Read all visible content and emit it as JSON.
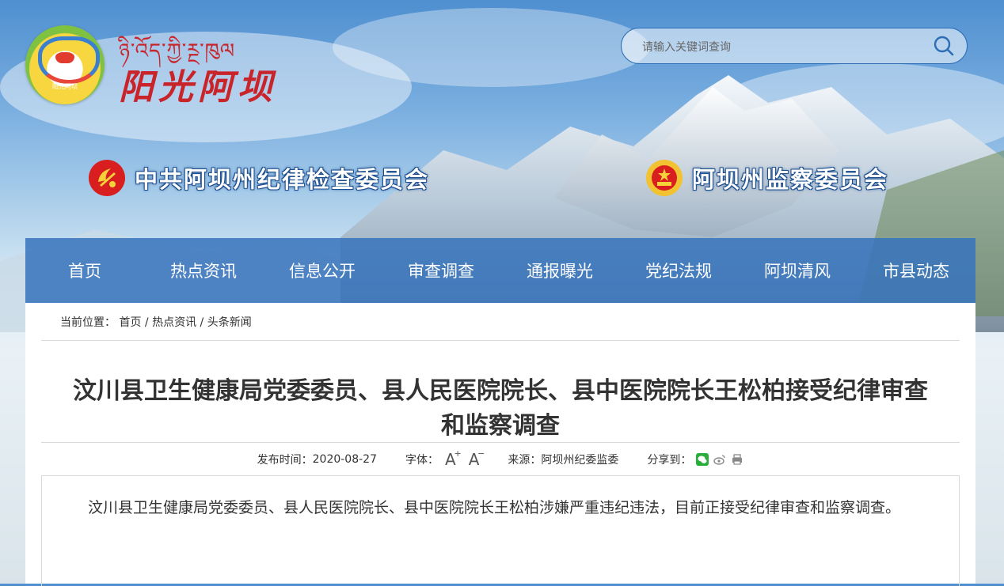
{
  "header": {
    "logo_caption": "阳光阿坝",
    "tibetan_title": "ཉི་འོད་ཀྱི་ཪྔ་ཁུལ",
    "brand_title": "阳光阿坝",
    "search": {
      "placeholder": "请输入关键词查询"
    },
    "orgs": [
      {
        "name": "中共阿坝州纪律检查委员会"
      },
      {
        "name": "阿坝州监察委员会"
      }
    ]
  },
  "nav": {
    "items": [
      "首页",
      "热点资讯",
      "信息公开",
      "审查调查",
      "通报曝光",
      "党纪法规",
      "阿坝清风",
      "市县动态"
    ]
  },
  "breadcrumb": {
    "prefix": "当前位置：",
    "items": [
      "首页",
      "热点资讯",
      "头条新闻"
    ],
    "separator": "/"
  },
  "article": {
    "title": "汶川县卫生健康局党委委员、县人民医院院长、县中医院院长王松柏接受纪律审查和监察调查",
    "published_label": "发布时间：",
    "published_date": "2020-08-27",
    "font_label": "字体：",
    "source_label": "来源：",
    "source": "阿坝州纪委监委",
    "share_label": "分享到：",
    "body": "汶川县卫生健康局党委委员、县人民医院院长、县中医院院长王松柏涉嫌严重违纪违法，目前正接受纪律审查和监察调查。"
  },
  "colors": {
    "nav_bg": "#3875bd",
    "brand_red": "#c8242a",
    "text": "#333333"
  }
}
